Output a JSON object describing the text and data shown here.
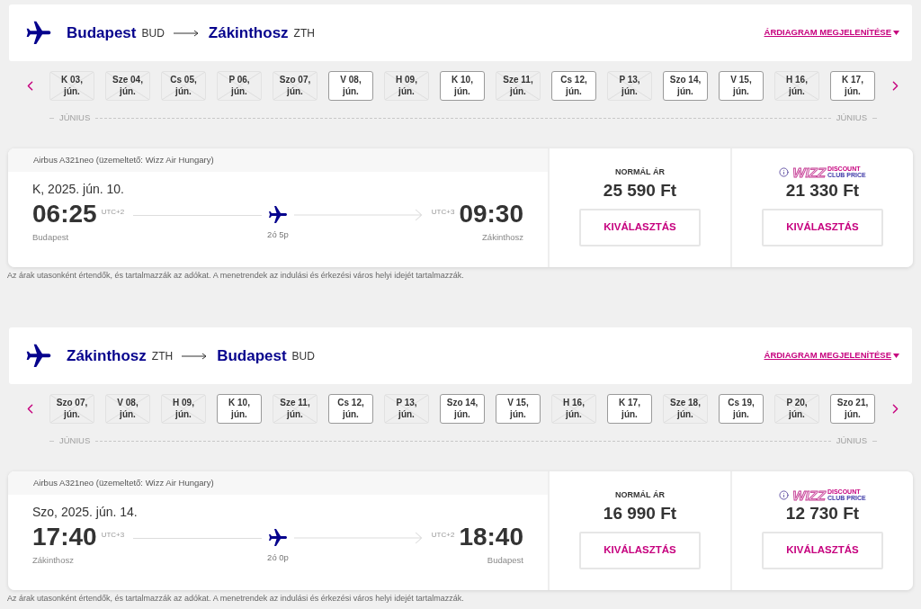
{
  "sections": [
    {
      "origin": {
        "city": "Budapest",
        "code": "BUD"
      },
      "destination": {
        "city": "Zákinthosz",
        "code": "ZTH"
      },
      "chart_link": "ÁRDIAGRAM MEGJELENÍTÉSE",
      "dates": [
        {
          "day": "K 03,",
          "month": "jún.",
          "available": false
        },
        {
          "day": "Sze 04,",
          "month": "jún.",
          "available": false
        },
        {
          "day": "Cs 05,",
          "month": "jún.",
          "available": false
        },
        {
          "day": "P 06,",
          "month": "jún.",
          "available": false
        },
        {
          "day": "Szo 07,",
          "month": "jún.",
          "available": false
        },
        {
          "day": "V 08,",
          "month": "jún.",
          "available": true
        },
        {
          "day": "H 09,",
          "month": "jún.",
          "available": false
        },
        {
          "day": "K 10,",
          "month": "jún.",
          "available": true
        },
        {
          "day": "Sze 11,",
          "month": "jún.",
          "available": false
        },
        {
          "day": "Cs 12,",
          "month": "jún.",
          "available": true
        },
        {
          "day": "P 13,",
          "month": "jún.",
          "available": false
        },
        {
          "day": "Szo 14,",
          "month": "jún.",
          "available": true
        },
        {
          "day": "V 15,",
          "month": "jún.",
          "available": true
        },
        {
          "day": "H 16,",
          "month": "jún.",
          "available": false
        },
        {
          "day": "K 17,",
          "month": "jún.",
          "available": true
        }
      ],
      "months": [
        "JÚNIUS",
        "JÚNIUS"
      ],
      "flight": {
        "aircraft": "Airbus A321neo (üzemeltető: Wizz Air Hungary)",
        "date": "K, 2025. jún. 10.",
        "departure": {
          "time": "06:25",
          "utc": "UTC+2",
          "city": "Budapest"
        },
        "duration": "2ó 5p",
        "arrival": {
          "time": "09:30",
          "utc": "UTC+3",
          "city": "Zákinthosz"
        }
      },
      "fares": [
        {
          "kind": "normal",
          "label": "NORMÁL ÁR",
          "price": "25 590 Ft",
          "button": "KIVÁLASZTÁS"
        },
        {
          "kind": "club",
          "brand": "WIZZ",
          "line1": "DISCOUNT",
          "line2": "CLUB PRICE",
          "price": "21 330 Ft",
          "button": "KIVÁLASZTÁS"
        }
      ],
      "note": "Az árak utasonként értendők, és tartalmazzák az adókat. A menetrendek az indulási és érkezési város helyi idejét tartalmazzák."
    },
    {
      "origin": {
        "city": "Zákinthosz",
        "code": "ZTH"
      },
      "destination": {
        "city": "Budapest",
        "code": "BUD"
      },
      "chart_link": "ÁRDIAGRAM MEGJELENÍTÉSE",
      "dates": [
        {
          "day": "Szo 07,",
          "month": "jún.",
          "available": false
        },
        {
          "day": "V 08,",
          "month": "jún.",
          "available": false
        },
        {
          "day": "H 09,",
          "month": "jún.",
          "available": false
        },
        {
          "day": "K 10,",
          "month": "jún.",
          "available": true
        },
        {
          "day": "Sze 11,",
          "month": "jún.",
          "available": false
        },
        {
          "day": "Cs 12,",
          "month": "jún.",
          "available": true
        },
        {
          "day": "P 13,",
          "month": "jún.",
          "available": false
        },
        {
          "day": "Szo 14,",
          "month": "jún.",
          "available": true
        },
        {
          "day": "V 15,",
          "month": "jún.",
          "available": true
        },
        {
          "day": "H 16,",
          "month": "jún.",
          "available": false
        },
        {
          "day": "K 17,",
          "month": "jún.",
          "available": true
        },
        {
          "day": "Sze 18,",
          "month": "jún.",
          "available": false
        },
        {
          "day": "Cs 19,",
          "month": "jún.",
          "available": true
        },
        {
          "day": "P 20,",
          "month": "jún.",
          "available": false
        },
        {
          "day": "Szo 21,",
          "month": "jún.",
          "available": true
        }
      ],
      "months": [
        "JÚNIUS",
        "JÚNIUS"
      ],
      "flight": {
        "aircraft": "Airbus A321neo (üzemeltető: Wizz Air Hungary)",
        "date": "Szo, 2025. jún. 14.",
        "departure": {
          "time": "17:40",
          "utc": "UTC+3",
          "city": "Zákinthosz"
        },
        "duration": "2ó 0p",
        "arrival": {
          "time": "18:40",
          "utc": "UTC+2",
          "city": "Budapest"
        }
      },
      "fares": [
        {
          "kind": "normal",
          "label": "NORMÁL ÁR",
          "price": "16 990 Ft",
          "button": "KIVÁLASZTÁS"
        },
        {
          "kind": "club",
          "brand": "WIZZ",
          "line1": "DISCOUNT",
          "line2": "CLUB PRICE",
          "price": "12 730 Ft",
          "button": "KIVÁLASZTÁS"
        }
      ],
      "note": "Az árak utasonként értendők, és tartalmazzák az adókat. A menetrendek az indulási és érkezési város helyi idejét tartalmazzák."
    }
  ]
}
